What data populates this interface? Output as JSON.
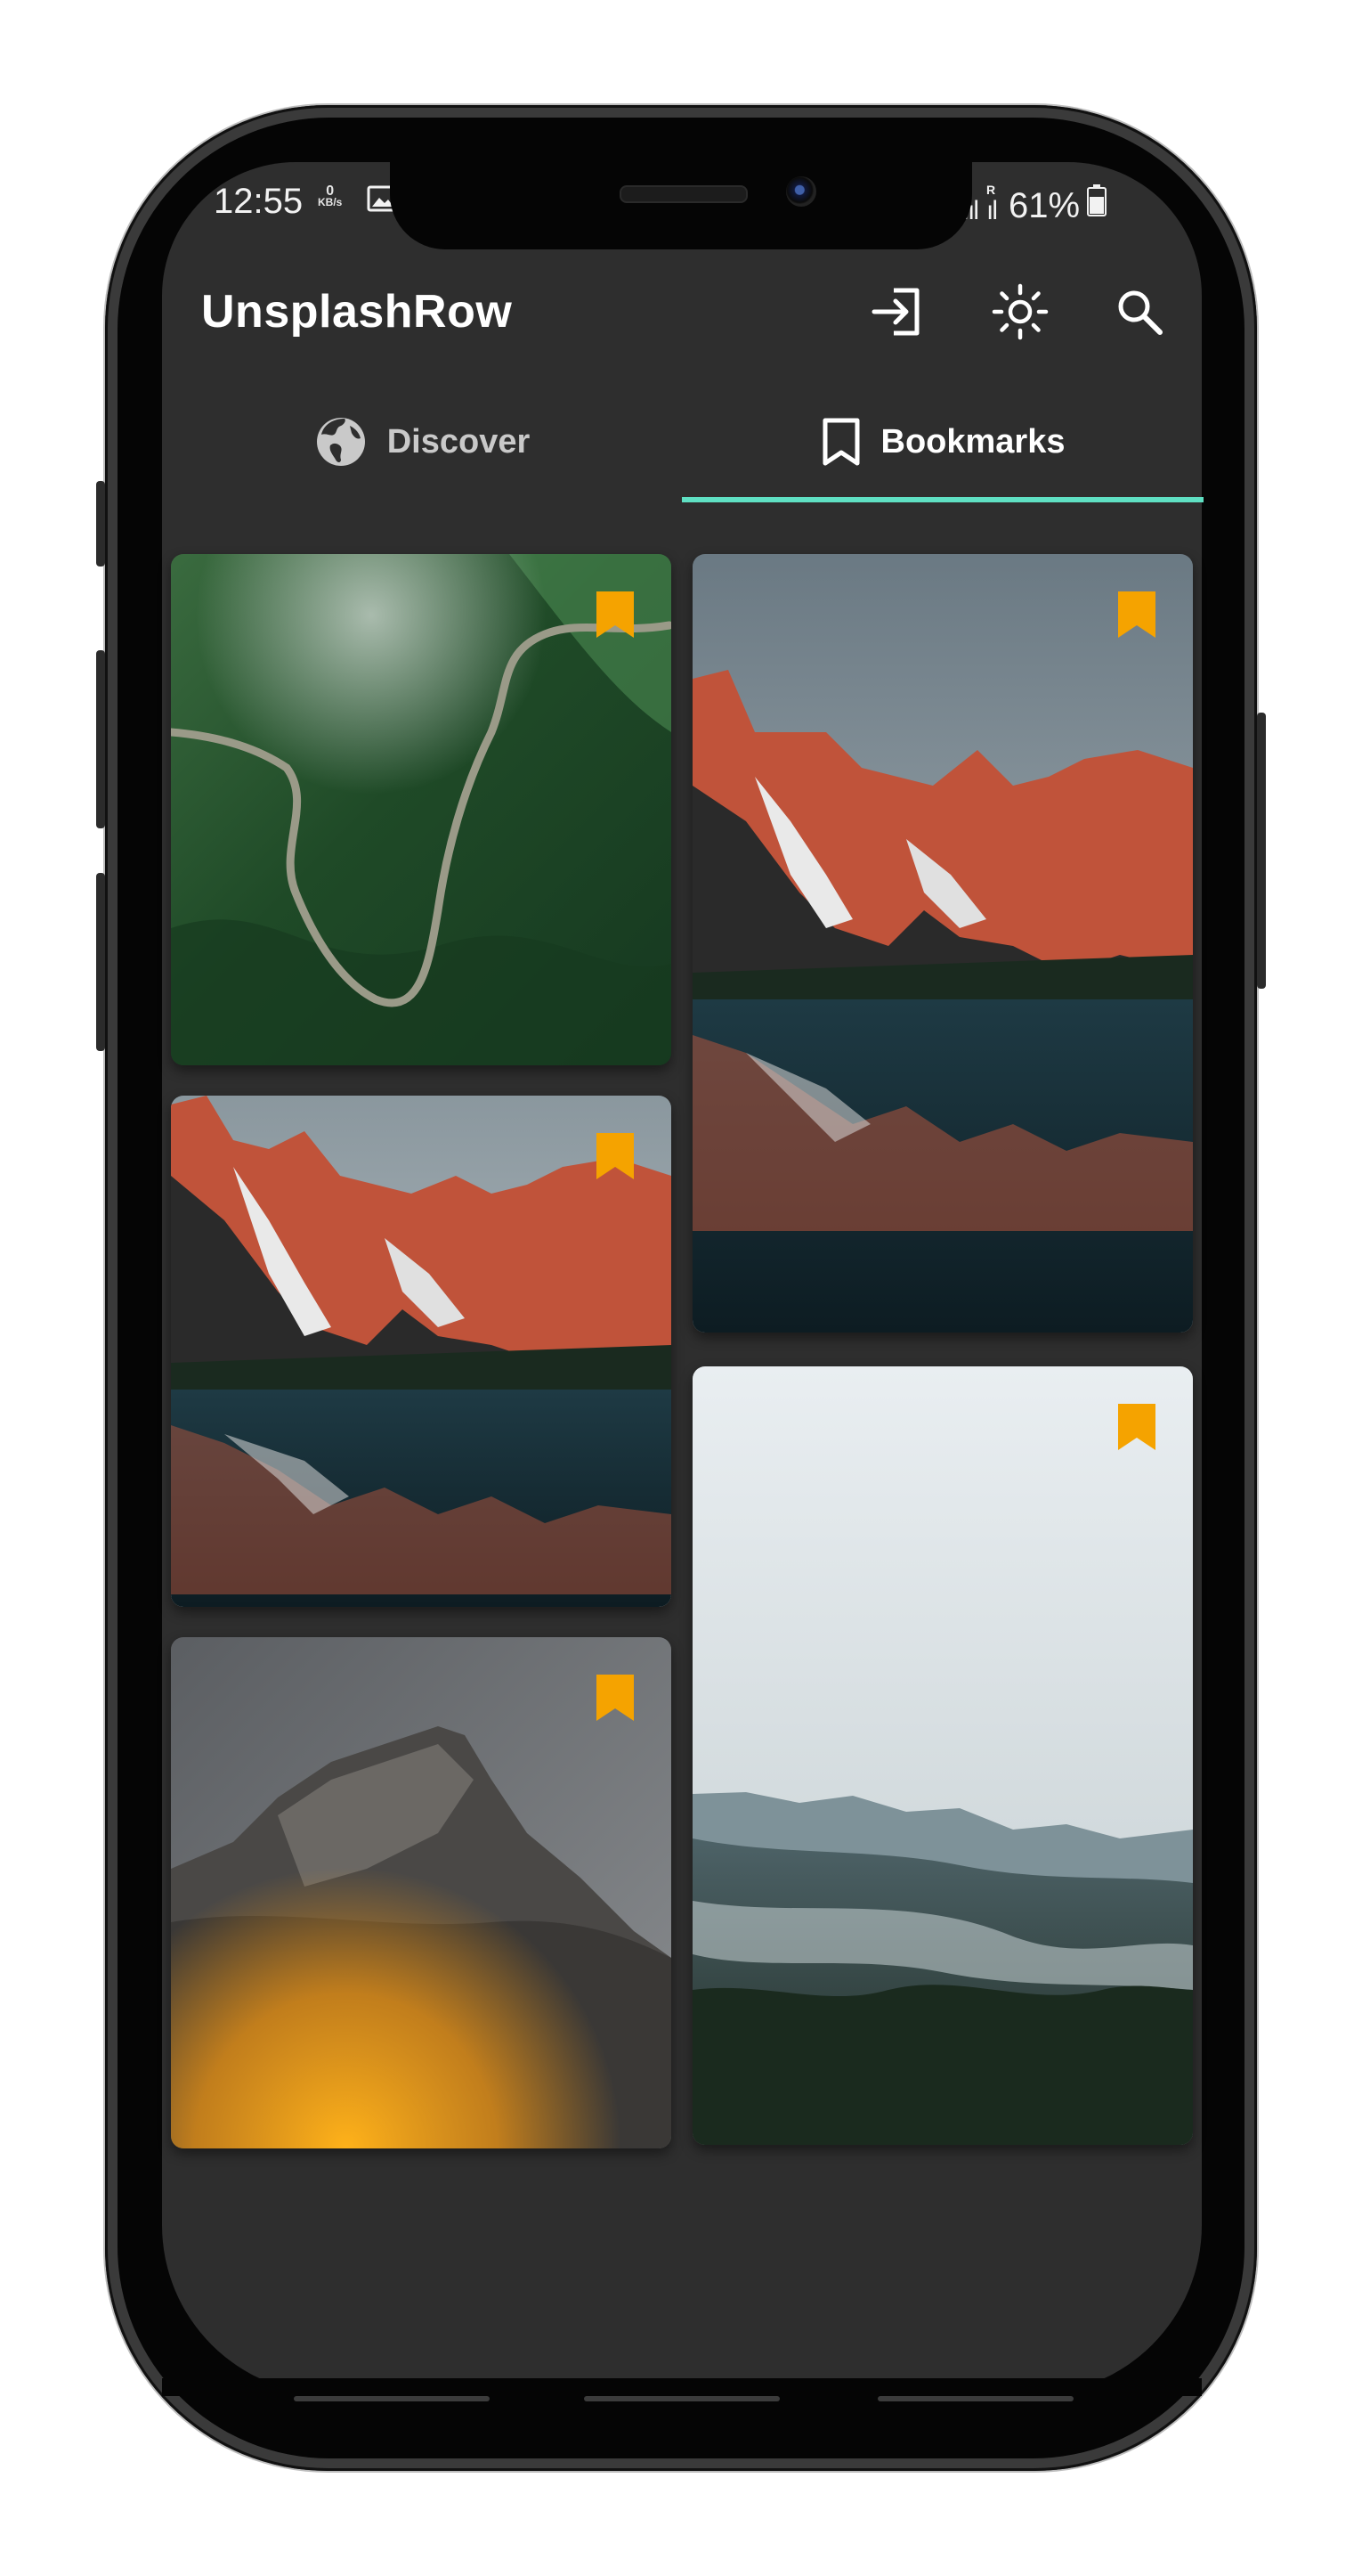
{
  "status_bar": {
    "time": "12:55",
    "net_speed_value": "0",
    "net_speed_unit": "KB/s",
    "signal_1": "4.ıl",
    "signal_2_roaming": "R",
    "signal_2": "ıl",
    "battery": "61%"
  },
  "app_bar": {
    "title": "UnsplashRow",
    "actions": [
      "login-icon",
      "brightness-icon",
      "search-icon"
    ]
  },
  "tabs": [
    {
      "label": "Discover",
      "icon": "globe-icon",
      "selected": false
    },
    {
      "label": "Bookmarks",
      "icon": "bookmark-outline-icon",
      "selected": true
    }
  ],
  "colors": {
    "background": "#2e2e2e",
    "tab_indicator": "#5fe0c3",
    "bookmark": "#f5a300",
    "tab_selected": "#ffffff",
    "tab_unselected": "#c9c9c9"
  },
  "gallery": [
    {
      "subject": "winding road on green mountain",
      "bookmarked": true
    },
    {
      "subject": "red mountains reflected in lake",
      "bookmarked": true
    },
    {
      "subject": "red mountains reflected in lake",
      "bookmarked": true
    },
    {
      "subject": "misty forest valley",
      "bookmarked": true
    },
    {
      "subject": "rocky peak above autumn foliage",
      "bookmarked": true
    }
  ]
}
